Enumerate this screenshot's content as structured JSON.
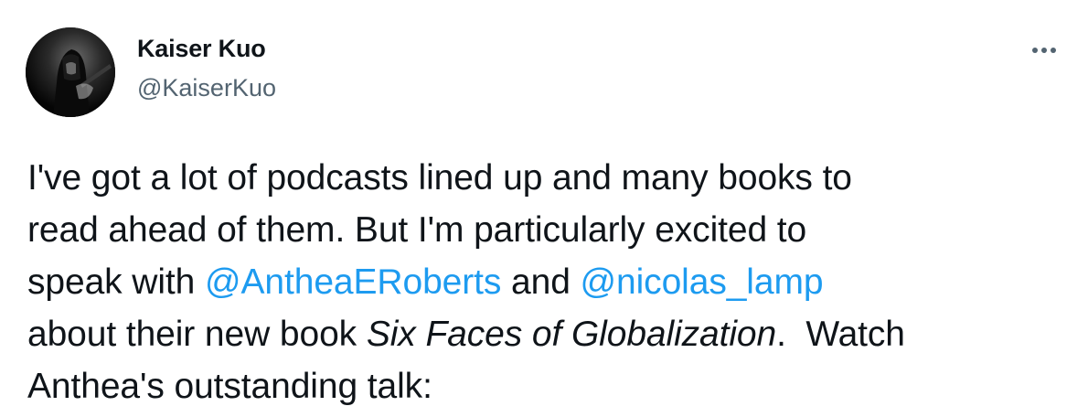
{
  "author": {
    "name": "Kaiser Kuo",
    "handle": "@KaiserKuo"
  },
  "menu": {
    "icon": "more-horizontal-icon"
  },
  "tweet": {
    "line1": "I've got a lot of podcasts lined up and many books to",
    "line2": "read ahead of them. But I'm particularly excited to",
    "line3_pre": "speak with ",
    "mention1": "@AntheaERoberts",
    "line3_mid": " and ",
    "mention2": "@nicolas_lamp",
    "line4_pre": "about their new book ",
    "book_title": "Six Faces of Globalization",
    "line4_post": ".  Watch",
    "line5": "Anthea's outstanding talk:"
  },
  "colors": {
    "text": "#0f1419",
    "secondary": "#536471",
    "link": "#1d9bf0",
    "background": "#ffffff"
  }
}
